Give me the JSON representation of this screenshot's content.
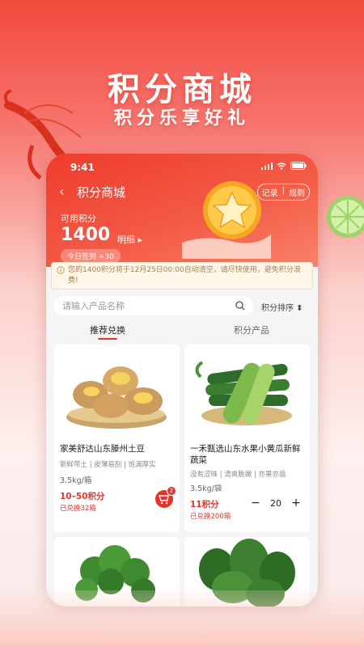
{
  "promo": {
    "title": "积分商城",
    "subtitle": "积分乐享好礼"
  },
  "status_bar": {
    "time": "9:41"
  },
  "nav": {
    "back_icon": "chevron-left-icon",
    "title": "积分商城",
    "records_label": "记录",
    "rules_label": "规则"
  },
  "points": {
    "label": "可用积分",
    "value": "1400",
    "detail_label": "明细 ▸",
    "sign_in": "今日签到 +30"
  },
  "notice": {
    "text": "您的1400积分将于12月25日00:00自动清空，请尽快使用，避免积分浪费!"
  },
  "search": {
    "placeholder": "请输入产品名称",
    "sort_label": "积分排序 ⬍"
  },
  "tabs": [
    {
      "label": "推荐兑换",
      "active": true
    },
    {
      "label": "积分产品",
      "active": false
    }
  ],
  "products": [
    {
      "name": "家美舒达山东滕州土豆",
      "tags": "新鲜带土 | 皮薄易刮 | 饱满厚实",
      "spec": "3.5kg/箱",
      "price": "10–50积分",
      "sold": "已兑换32箱",
      "cart_count": "2"
    },
    {
      "name": "一禾甄选山东水果小黄瓜新鲜蔬菜",
      "tags": "没有涩味 | 清爽脆嫩 | 亦果亦蔬",
      "spec": "3.5kg/袋",
      "price": "11积分",
      "sold": "已兑换200箱",
      "quantity": "20"
    }
  ],
  "colors": {
    "accent": "#e8322a",
    "header_gradient_start": "#ee3b2d",
    "notice_bg": "#fff6ea"
  }
}
